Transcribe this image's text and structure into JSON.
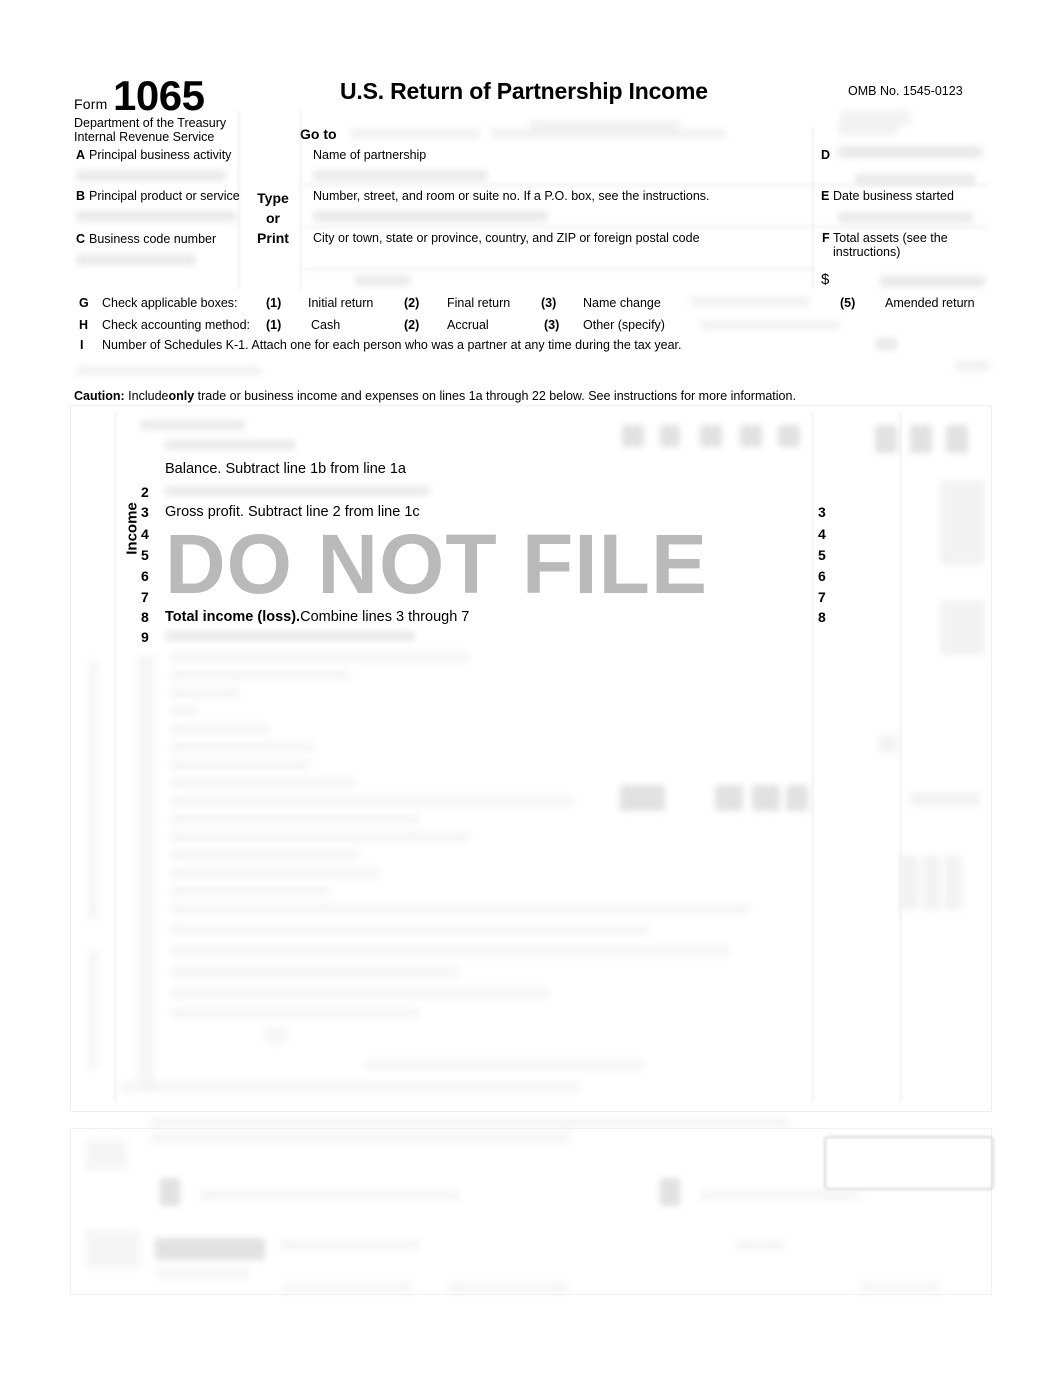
{
  "document": {
    "form_label": "Form",
    "form_number": "1065",
    "agency_line1": "Department of the Treasury",
    "agency_line2": "Internal Revenue Service",
    "title": "U.S. Return of Partnership Income",
    "omb": "OMB No. 1545-0123",
    "goto_label": "Go to",
    "watermark": "DO NOT FILE"
  },
  "header_fields": {
    "a_letter": "A",
    "a_label": "Principal business activity",
    "b_letter": "B",
    "b_label": "Principal product or service",
    "c_letter": "C",
    "c_label": "Business code number",
    "type_or_print": "Type\nor\nPrint",
    "type_line1": "Type",
    "type_line2": "or",
    "type_line3": "Print",
    "name_of_partnership": "Name of partnership",
    "street_address": "Number, street, and room or suite no. If a P.O. box, see the instructions.",
    "city_state": "City or town, state or province, country, and ZIP or foreign postal code",
    "d_letter": "D",
    "e_letter": "E",
    "e_label": "Date business started",
    "f_letter": "F",
    "f_label": "Total assets (see the instructions)",
    "f_currency": "$"
  },
  "checkbox_rows": {
    "g": {
      "letter": "G",
      "label": "Check applicable boxes:",
      "options": [
        {
          "num": "(1)",
          "label": "Initial return"
        },
        {
          "num": "(2)",
          "label": "Final return"
        },
        {
          "num": "(3)",
          "label": "Name change"
        },
        {
          "num": "(5)",
          "label": "Amended return"
        }
      ]
    },
    "h": {
      "letter": "H",
      "label": "Check accounting method:",
      "options": [
        {
          "num": "(1)",
          "label": "Cash"
        },
        {
          "num": "(2)",
          "label": "Accrual"
        },
        {
          "num": "(3)",
          "label": "Other (specify)"
        }
      ]
    },
    "i": {
      "letter": "I",
      "label": "Number of Schedules K-1. Attach one for each person who was a partner at any time during the tax year."
    }
  },
  "caution": {
    "heading": "Caution:",
    "text_1": "Include",
    "text_bold": "only",
    "text_2": "trade or business income and expenses on lines 1a through 22 below. See instructions for more information."
  },
  "income": {
    "section_label": "Income",
    "lines": [
      {
        "num": "",
        "text_bold": "",
        "text": "Balance. Subtract line 1b from line 1a",
        "right_num": ""
      },
      {
        "num": "2",
        "text_bold": "",
        "text": "",
        "right_num": ""
      },
      {
        "num": "3",
        "text_bold": "",
        "text": "Gross profit. Subtract line 2 from line 1c",
        "right_num": "3"
      },
      {
        "num": "4",
        "text_bold": "",
        "text": "",
        "right_num": "4"
      },
      {
        "num": "5",
        "text_bold": "",
        "text": "",
        "right_num": "5"
      },
      {
        "num": "6",
        "text_bold": "",
        "text": "",
        "right_num": "6"
      },
      {
        "num": "7",
        "text_bold": "",
        "text": "",
        "right_num": "7"
      },
      {
        "num": "8",
        "text_bold": "Total  income  (loss).",
        "text": "Combine lines 3 through 7",
        "right_num": "8"
      },
      {
        "num": "9",
        "text_bold": "",
        "text": "",
        "right_num": ""
      }
    ]
  }
}
